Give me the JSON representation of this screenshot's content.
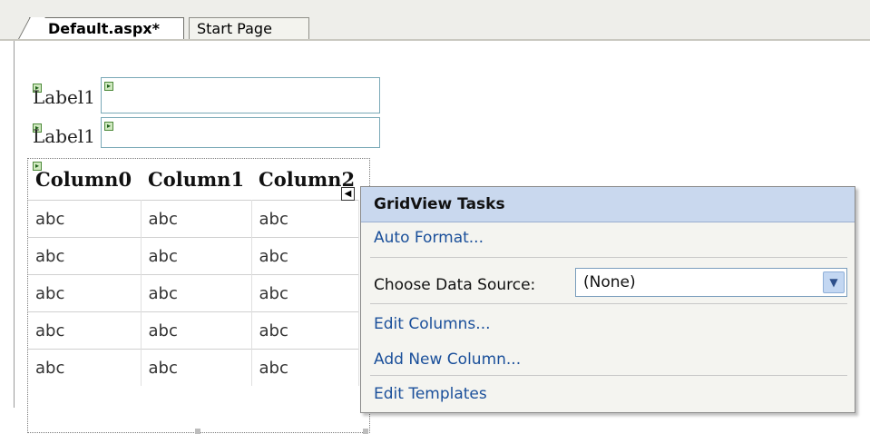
{
  "tabs": [
    {
      "label": "Default.aspx*",
      "active": true
    },
    {
      "label": "Start Page",
      "active": false
    }
  ],
  "form": {
    "label1": "Label",
    "label2": "Label",
    "label1_suffix": "1",
    "label2_suffix": "1"
  },
  "grid": {
    "columns": [
      "Column0",
      "Column1",
      "Column2"
    ],
    "rows": [
      [
        "abc",
        "abc",
        "abc"
      ],
      [
        "abc",
        "abc",
        "abc"
      ],
      [
        "abc",
        "abc",
        "abc"
      ],
      [
        "abc",
        "abc",
        "abc"
      ],
      [
        "abc",
        "abc",
        "abc"
      ]
    ]
  },
  "tasks_panel": {
    "title": "GridView Tasks",
    "auto_format": "Auto Format...",
    "choose_data_source_label": "Choose Data Source:",
    "data_source_value": "(None)",
    "edit_columns": "Edit Columns...",
    "add_new_column": "Add New Column...",
    "edit_templates": "Edit Templates"
  },
  "colors": {
    "header_bg": "#c9d8ee",
    "link": "#1a4f9a",
    "marker_green": "#4d8a3a"
  }
}
